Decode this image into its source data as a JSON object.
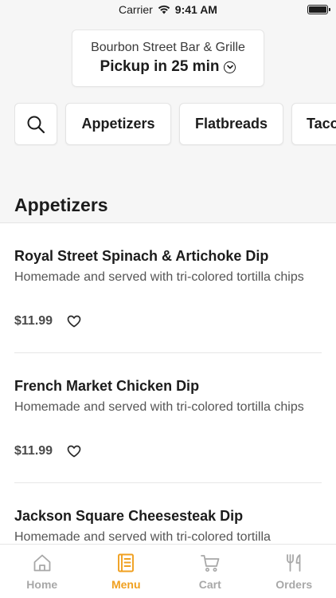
{
  "status_bar": {
    "carrier": "Carrier",
    "time": "9:41 AM"
  },
  "store": {
    "name": "Bourbon Street Bar & Grille",
    "pickup": "Pickup in 25 min"
  },
  "categories": [
    "Appetizers",
    "Flatbreads",
    "Tacos"
  ],
  "section": {
    "title": "Appetizers"
  },
  "menu_items": [
    {
      "name": "Royal Street Spinach & Artichoke Dip",
      "description": "Homemade and served with tri-colored tortilla chips",
      "price": "$11.99"
    },
    {
      "name": "French Market Chicken Dip",
      "description": "Homemade and served with tri-colored tortilla chips",
      "price": "$11.99"
    },
    {
      "name": "Jackson Square Cheesesteak Dip",
      "description": "Homemade and served with tri-colored tortilla",
      "price": ""
    }
  ],
  "tabs": [
    {
      "label": "Home",
      "icon": "home-icon",
      "active": false
    },
    {
      "label": "Menu",
      "icon": "menu-book-icon",
      "active": true
    },
    {
      "label": "Cart",
      "icon": "cart-icon",
      "active": false
    },
    {
      "label": "Orders",
      "icon": "fork-knife-icon",
      "active": false
    }
  ],
  "colors": {
    "accent": "#f0a020",
    "inactive_tab": "#a8a8a8",
    "background": "#f6f6f6"
  }
}
